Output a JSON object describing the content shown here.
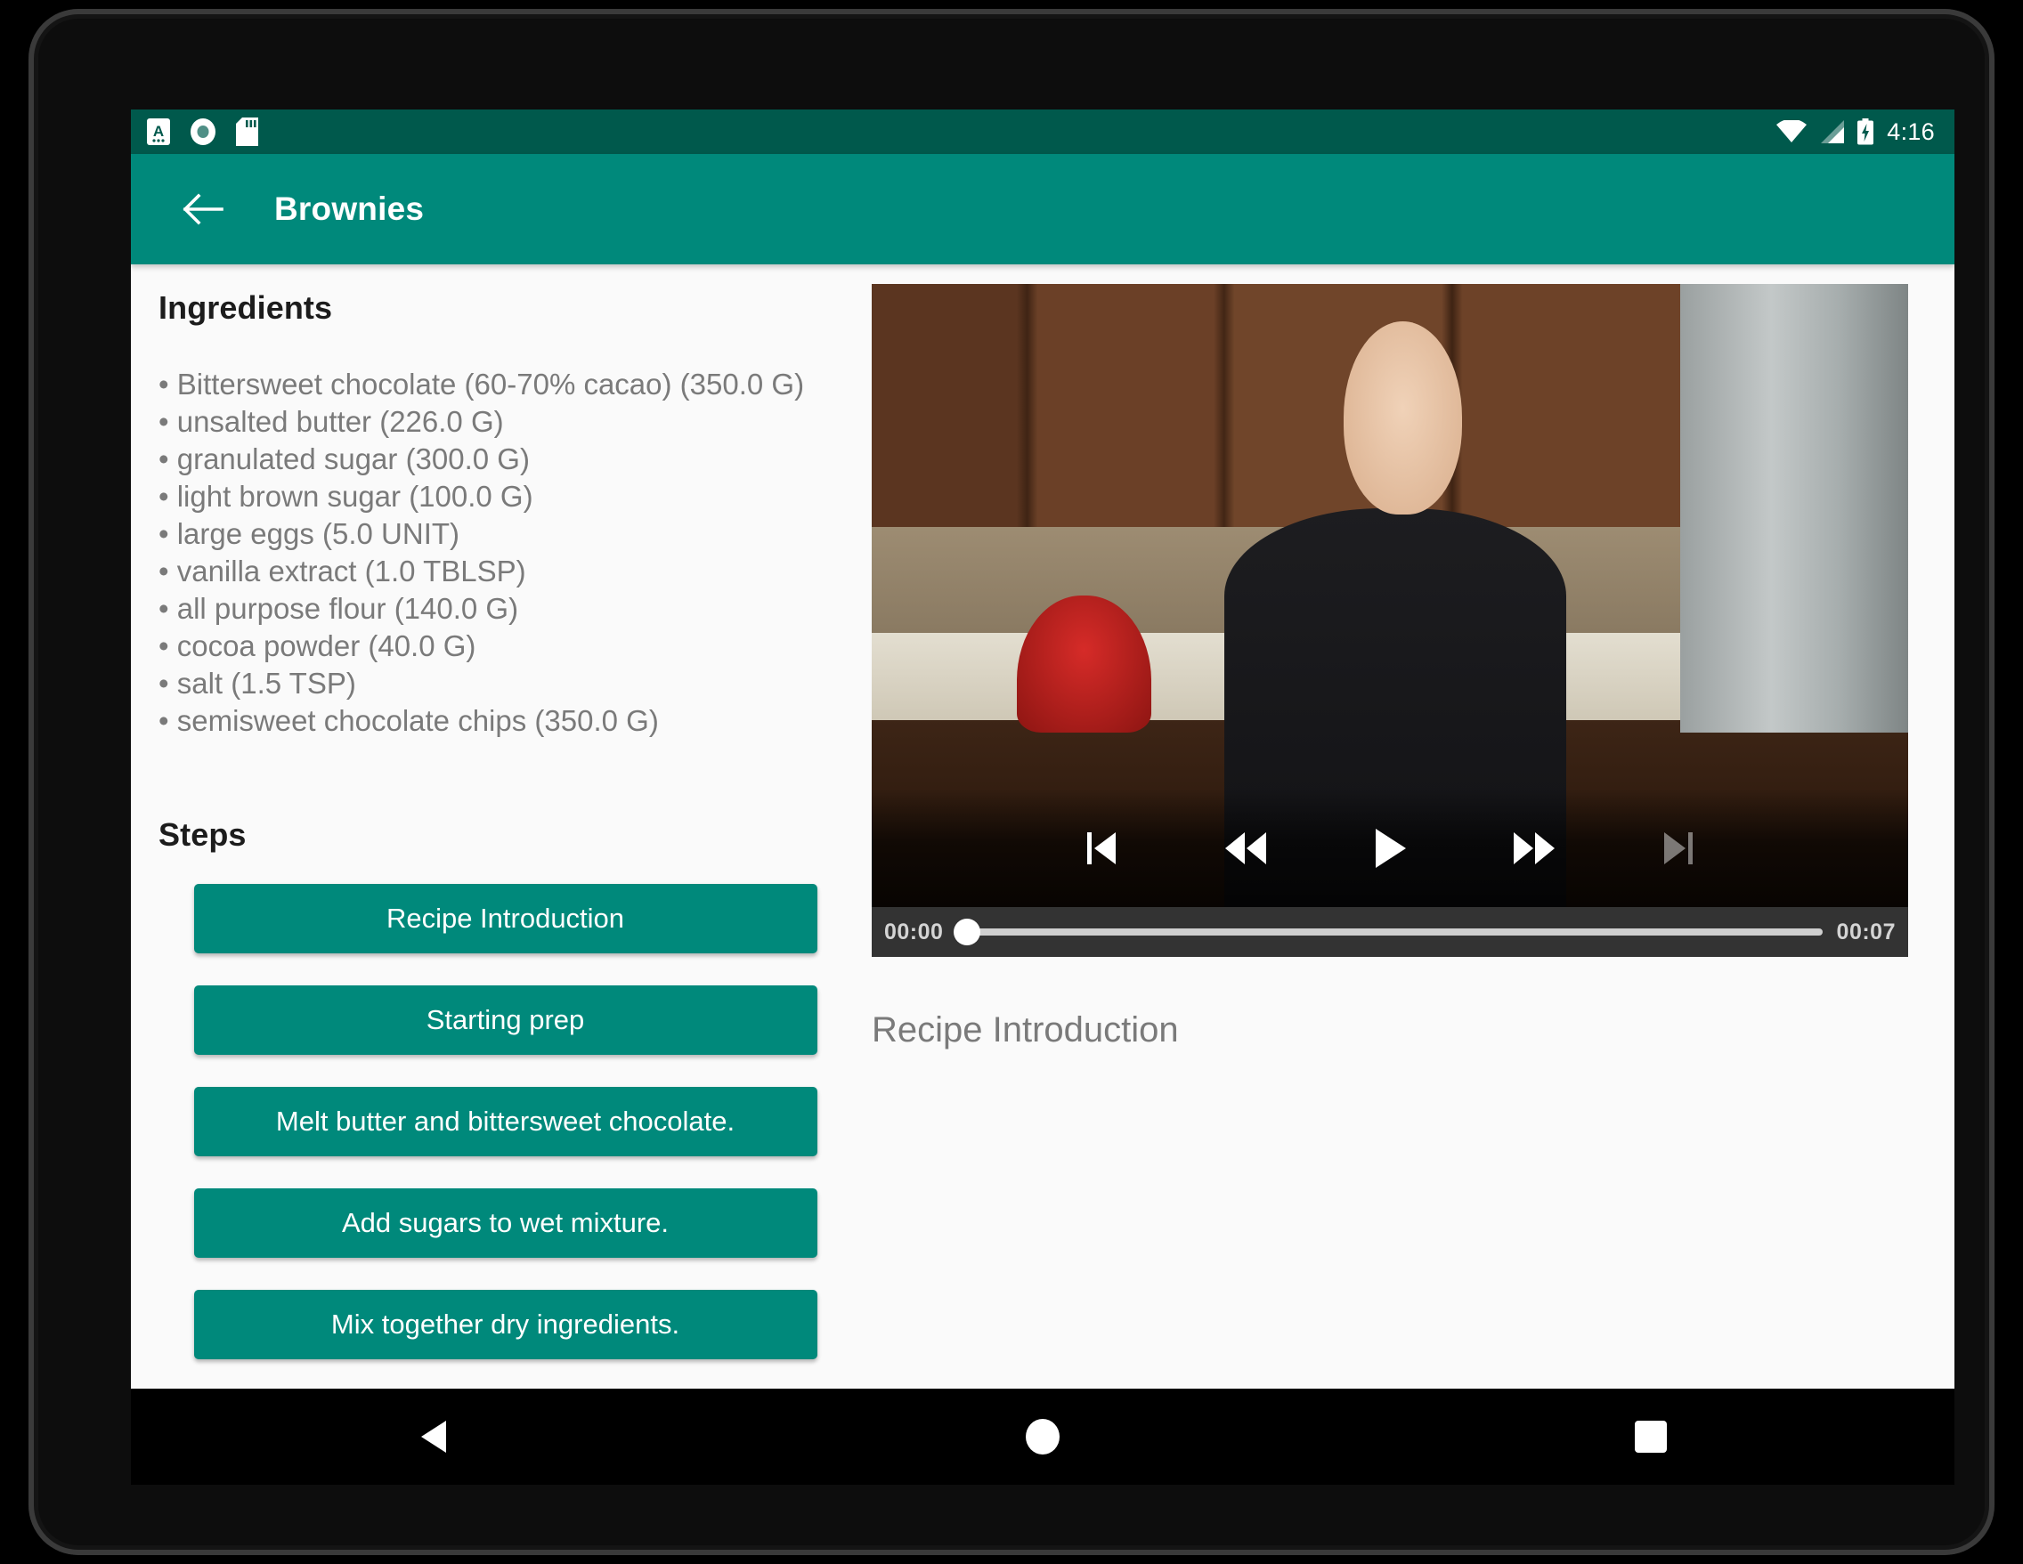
{
  "status_bar": {
    "notification_icons": [
      "text-input-icon",
      "disc-icon",
      "sd-card-icon"
    ],
    "wifi_icon": "wifi-icon",
    "signal_icon": "cell-signal-icon",
    "battery_icon": "battery-charging-icon",
    "time": "4:16"
  },
  "app_bar": {
    "back_icon": "back-arrow-icon",
    "title": "Brownies",
    "background_color": "#00897b"
  },
  "ingredients": {
    "heading": "Ingredients",
    "items": [
      "• Bittersweet chocolate (60-70% cacao) (350.0 G)",
      "• unsalted butter (226.0 G)",
      "• granulated sugar (300.0 G)",
      "• light brown sugar (100.0 G)",
      "• large eggs (5.0 UNIT)",
      "• vanilla extract (1.0 TBLSP)",
      "• all purpose flour (140.0 G)",
      "• cocoa powder (40.0 G)",
      "• salt (1.5 TSP)",
      "• semisweet chocolate chips (350.0 G)"
    ]
  },
  "steps": {
    "heading": "Steps",
    "buttons": [
      "Recipe Introduction",
      "Starting prep",
      "Melt butter and bittersweet chocolate.",
      "Add sugars to wet mixture.",
      "Mix together dry ingredients."
    ]
  },
  "video_player": {
    "controls": [
      {
        "name": "skip-previous-icon",
        "label": "Skip to previous",
        "enabled": true
      },
      {
        "name": "rewind-icon",
        "label": "Rewind",
        "enabled": true
      },
      {
        "name": "play-icon",
        "label": "Play",
        "enabled": true
      },
      {
        "name": "fast-forward-icon",
        "label": "Fast forward",
        "enabled": true
      },
      {
        "name": "skip-next-icon",
        "label": "Skip to next",
        "enabled": false
      }
    ],
    "current_time": "00:00",
    "duration": "00:07",
    "progress_percent": 0,
    "current_step_title": "Recipe Introduction"
  },
  "nav_bar": {
    "back_icon": "nav-back-icon",
    "home_icon": "nav-home-icon",
    "recents_icon": "nav-recents-icon"
  },
  "colors": {
    "accent": "#00897b",
    "status_bar": "#00594c",
    "background": "#fafafa",
    "body_text": "#7a7a7a",
    "heading_text": "#1c1c1c"
  }
}
